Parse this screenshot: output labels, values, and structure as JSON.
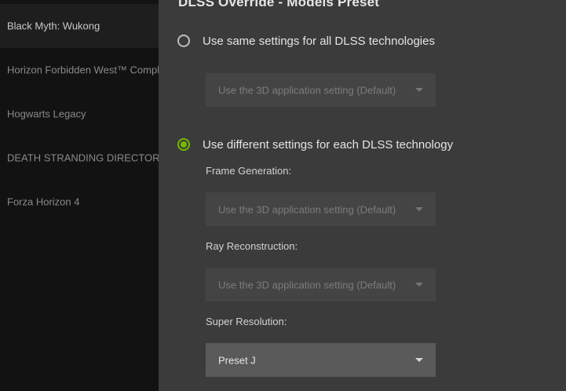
{
  "sidebar": {
    "items": [
      {
        "label": "Black Myth: Wukong"
      },
      {
        "label": "Horizon Forbidden West™ Complete Edition"
      },
      {
        "label": "Hogwarts Legacy"
      },
      {
        "label": "DEATH STRANDING DIRECTOR'S CUT"
      },
      {
        "label": "Forza Horizon 4"
      }
    ]
  },
  "panel": {
    "title": "DLSS Override - Models Preset",
    "option_same": {
      "label": "Use same settings for all DLSS technologies",
      "checked": false,
      "dropdown_value": "Use the 3D application setting (Default)"
    },
    "option_different": {
      "label": "Use different settings for each DLSS technology",
      "checked": true
    },
    "frame_generation": {
      "label": "Frame Generation:",
      "value": "Use the 3D application setting (Default)"
    },
    "ray_reconstruction": {
      "label": "Ray Reconstruction:",
      "value": "Use the 3D application setting (Default)"
    },
    "super_resolution": {
      "label": "Super Resolution:",
      "value": "Preset J"
    }
  },
  "colors": {
    "accent": "#76b900",
    "panel_bg": "#3b3b3b",
    "sidebar_bg": "#121212"
  }
}
